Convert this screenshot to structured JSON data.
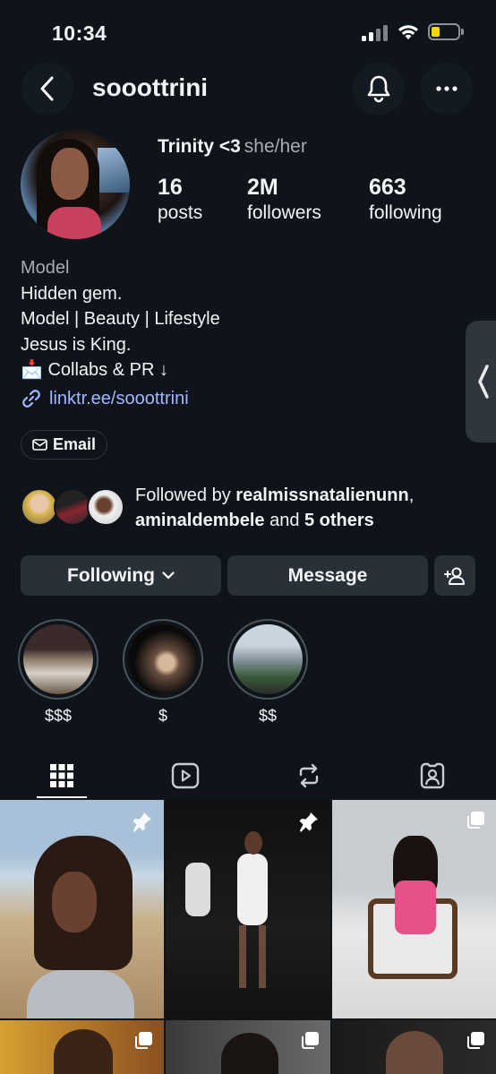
{
  "status_bar": {
    "time": "10:34"
  },
  "header": {
    "username": "sooottrini"
  },
  "profile": {
    "full_name": "Trinity <3",
    "pronouns": "she/her",
    "stats": [
      {
        "value": "16",
        "label": "posts"
      },
      {
        "value": "2M",
        "label": "followers"
      },
      {
        "value": "663",
        "label": "following"
      }
    ],
    "category": "Model",
    "bio_lines": [
      "Hidden gem.",
      "Model | Beauty | Lifestyle",
      "Jesus is King."
    ],
    "collab_line": "Collabs & PR ↓",
    "collab_emoji": "📩",
    "link": "linktr.ee/sooottrini",
    "email_button": "Email"
  },
  "followed_by": {
    "prefix": "Followed by ",
    "user1": "realmissnatalienunn",
    "sep": ",",
    "user2": "aminaldembele",
    "and": " and ",
    "others": "5 others"
  },
  "actions": {
    "following": "Following",
    "message": "Message"
  },
  "highlights": [
    {
      "label": "$$$"
    },
    {
      "label": "$"
    },
    {
      "label": "$$"
    }
  ],
  "tabs": [
    "posts-grid",
    "reels",
    "reposts",
    "tagged"
  ],
  "colors": {
    "background": "#0f141a",
    "button": "#2a3038",
    "link": "#a5b7ff",
    "battery": "#f5d21c"
  }
}
